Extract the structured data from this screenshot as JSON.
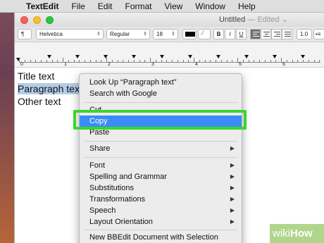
{
  "menubar": {
    "apple": "",
    "items": [
      "TextEdit",
      "File",
      "Edit",
      "Format",
      "View",
      "Window",
      "Help"
    ]
  },
  "window": {
    "title": "Untitled",
    "separator": "—",
    "status": "Edited",
    "status_chevron": "⌄"
  },
  "toolbar": {
    "paragraph_style": "¶",
    "font_family": "Helvetica",
    "font_style": "Regular",
    "font_size": "18",
    "bold": "B",
    "italic": "I",
    "underline": "U",
    "line_spacing": "1.0",
    "list": "•≡",
    "text_color": "#000000"
  },
  "ruler": {
    "numbers": [
      "0",
      "1",
      "2",
      "3",
      "4",
      "5",
      "6"
    ]
  },
  "document": {
    "lines": [
      "Title text",
      "Paragraph text",
      "Other text"
    ],
    "paragraph_visible": "Paragraph tex"
  },
  "context_menu": {
    "items": {
      "look_up": "Look Up “Paragraph text”",
      "search_google": "Search with Google",
      "cut": "Cut",
      "copy": "Copy",
      "paste": "Paste",
      "share": "Share",
      "font": "Font",
      "spelling": "Spelling and Grammar",
      "substitutions": "Substitutions",
      "transformations": "Transformations",
      "speech": "Speech",
      "layout_orientation": "Layout Orientation",
      "new_bbedit": "New BBEdit Document with Selection"
    },
    "selected": "copy",
    "submenu_arrow": "▶",
    "highlight_color": "#3b8cf6",
    "callout_color": "#3bd42e"
  },
  "watermark": {
    "part1": "wiki",
    "part2": "How"
  }
}
